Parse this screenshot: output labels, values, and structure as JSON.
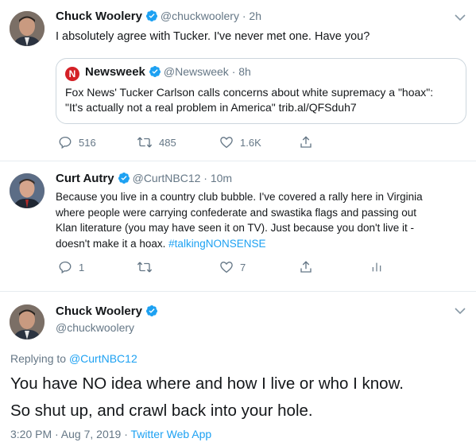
{
  "tweet1": {
    "name": "Chuck Woolery",
    "handle": "@chuckwoolery",
    "dot": "·",
    "time": "2h",
    "text": "I absolutely agree with Tucker. I've never met one. Have you?",
    "quote": {
      "name": "Newsweek",
      "handle": "@Newsweek",
      "dot": "·",
      "time": "8h",
      "logo_letter": "N",
      "text": "Fox News' Tucker Carlson calls concerns about white supremacy a \"hoax\":\n\"It's actually not a real problem in America\" trib.al/QFSduh7"
    },
    "replies": "516",
    "retweets": "485",
    "likes": "1.6K"
  },
  "tweet2": {
    "name": "Curt Autry",
    "handle": "@CurtNBC12",
    "dot": "·",
    "time": "10m",
    "text": "Because you live in a country club bubble. I've covered a rally here in Virginia\nwhere people were carrying confederate and swastika flags and passing out\nKlan literature (you may have seen it on TV). Just because you don't live it -\ndoesn't make it a hoax. ",
    "hashtag": "#talkingNONSENSE",
    "replies": "1",
    "likes": "7"
  },
  "tweet3": {
    "name": "Chuck Woolery",
    "handle": "@chuckwoolery",
    "replying_prefix": "Replying to ",
    "replying_to": "@CurtNBC12",
    "line1": "You have NO idea where and how I live or who I know.",
    "line2": "So shut up, and crawl back into your hole.",
    "timestamp": "3:20 PM · Aug 7, 2019 · ",
    "source": "Twitter Web App"
  },
  "colors": {
    "accent": "#1da1f2",
    "muted": "#657786",
    "text": "#14171a",
    "border": "#e6ecf0",
    "newsweek_red": "#d42026"
  },
  "icons": [
    "verified-badge-icon",
    "chevron-down-icon",
    "reply-icon",
    "retweet-icon",
    "like-icon",
    "share-icon",
    "analytics-icon"
  ]
}
